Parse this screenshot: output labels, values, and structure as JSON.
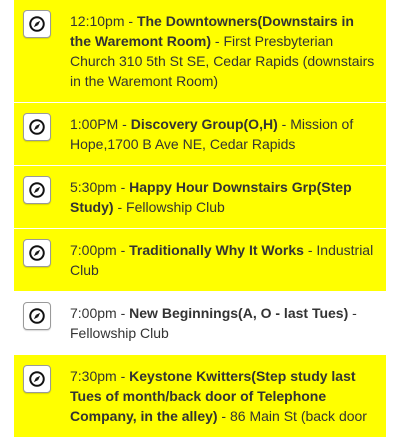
{
  "meetings": [
    {
      "time": "12:10pm",
      "name": "The Downtowners(Downstairs in the Waremont Room)",
      "location": "First Presbyterian Church 310 5th St SE, Cedar Rapids (downstairs in the Waremont Room)",
      "highlighted": true,
      "icon": "compass-icon"
    },
    {
      "time": "1:00PM",
      "name": "Discovery Group(O,H)",
      "location": "Mission of Hope,1700 B Ave NE, Cedar Rapids",
      "highlighted": true,
      "icon": "compass-icon"
    },
    {
      "time": "5:30pm",
      "name": "Happy Hour Downstairs Grp(Step Study)",
      "location": "Fellowship Club",
      "highlighted": true,
      "icon": "compass-icon"
    },
    {
      "time": "7:00pm",
      "name": "Traditionally Why It Works",
      "location": "Industrial Club",
      "highlighted": true,
      "icon": "compass-icon"
    },
    {
      "time": "7:00pm",
      "name": "New Beginnings(A, O - last Tues)",
      "location": "Fellowship Club",
      "highlighted": false,
      "icon": "compass-icon"
    },
    {
      "time": "7:30pm",
      "name": "Keystone Kwitters(Step study last Tues of month/back door of Telephone Company, in the alley)",
      "location": "86 Main St (back door",
      "highlighted": true,
      "icon": "compass-icon"
    }
  ],
  "separator": " - ",
  "colors": {
    "highlight": "#ffff00",
    "text": "#333333"
  }
}
